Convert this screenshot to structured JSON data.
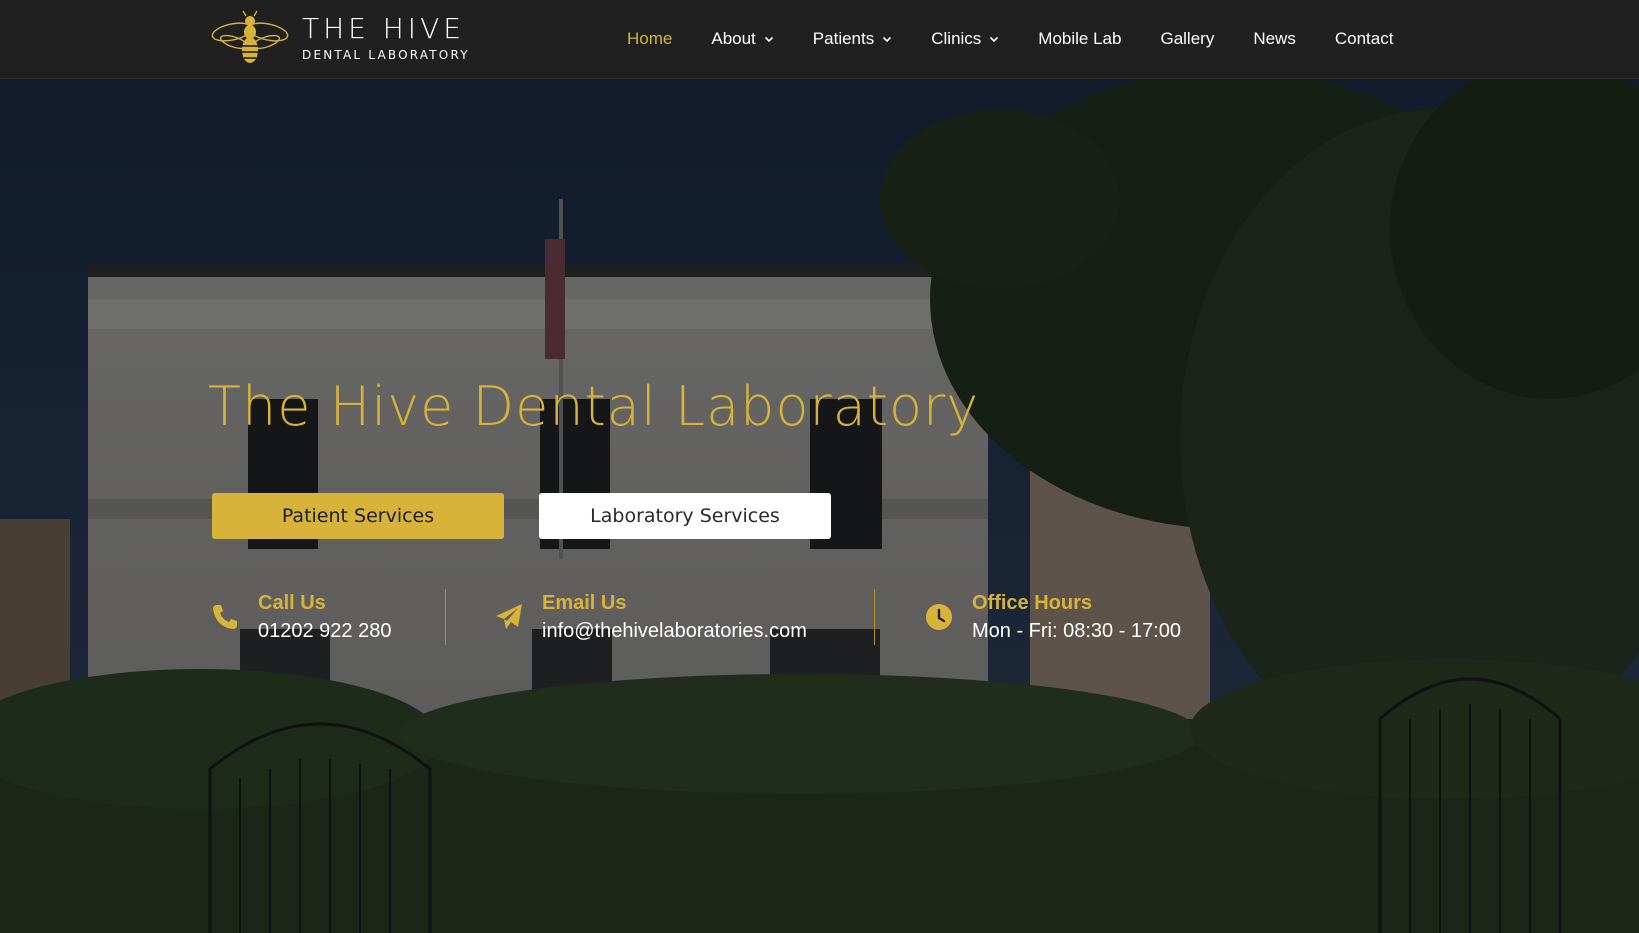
{
  "brand": {
    "title": "THE HIVE",
    "subtitle": "DENTAL LABORATORY",
    "accent_color": "#d8b33a",
    "icon": "bee-icon"
  },
  "nav": {
    "items": [
      {
        "label": "Home",
        "active": true,
        "dropdown": false
      },
      {
        "label": "About",
        "active": false,
        "dropdown": true
      },
      {
        "label": "Patients",
        "active": false,
        "dropdown": true
      },
      {
        "label": "Clinics",
        "active": false,
        "dropdown": true
      },
      {
        "label": "Mobile Lab",
        "active": false,
        "dropdown": false
      },
      {
        "label": "Gallery",
        "active": false,
        "dropdown": false
      },
      {
        "label": "News",
        "active": false,
        "dropdown": false
      },
      {
        "label": "Contact",
        "active": false,
        "dropdown": false
      }
    ]
  },
  "hero": {
    "title": "The Hive Dental Laboratory",
    "primary_button": "Patient Services",
    "secondary_button": "Laboratory Services",
    "contacts": [
      {
        "icon": "phone-icon",
        "label": "Call Us",
        "value": "01202 922 280"
      },
      {
        "icon": "paper-plane-icon",
        "label": "Email Us",
        "value": "info@thehivelaboratories.com"
      },
      {
        "icon": "clock-icon",
        "label": "Office Hours",
        "value": "Mon - Fri: 08:30 - 17:00"
      }
    ]
  }
}
